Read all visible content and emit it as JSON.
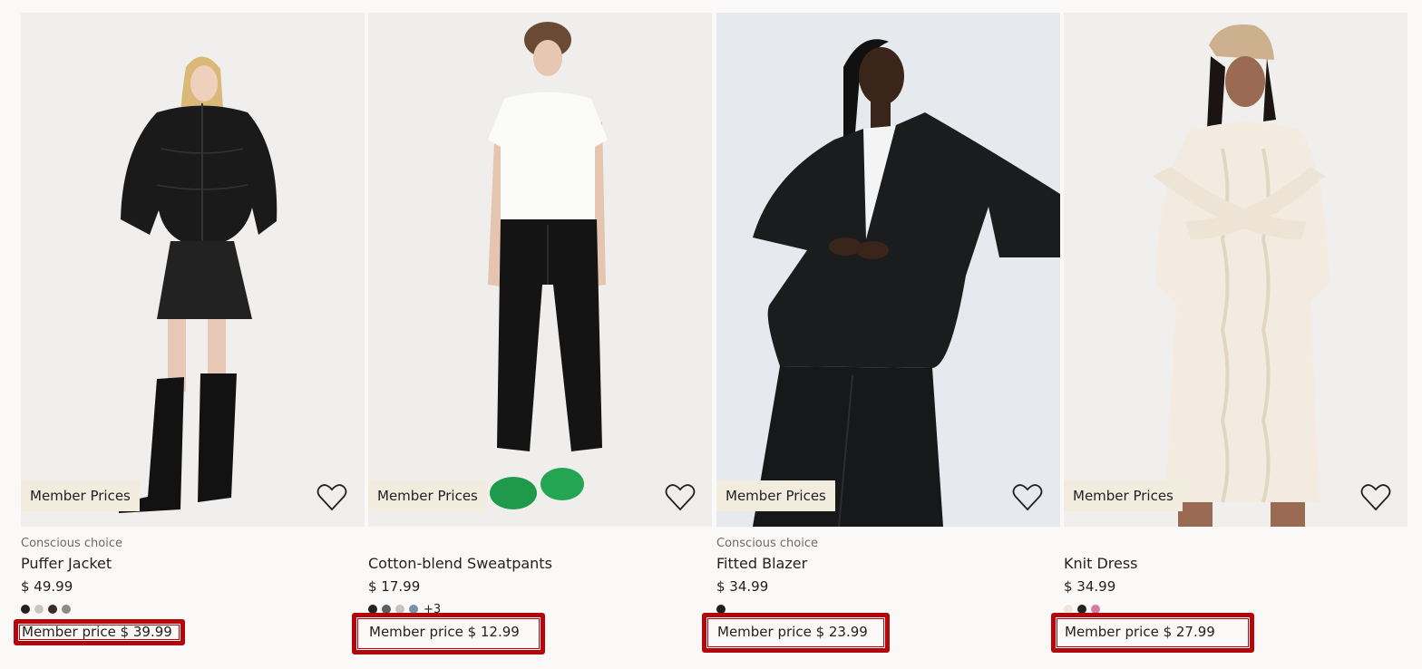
{
  "products": [
    {
      "tag": "Conscious choice",
      "name": "Puffer Jacket",
      "price": "$ 49.99",
      "badge": "Member Prices",
      "member_price": "Member price $ 39.99",
      "swatches": [
        "#222222",
        "#c9c7bd",
        "#3b2a27",
        "#8b8d84"
      ],
      "more": ""
    },
    {
      "tag": "",
      "name": "Cotton-blend Sweatpants",
      "price": "$ 17.99",
      "badge": "Member Prices",
      "member_price": "Member price $ 12.99",
      "swatches": [
        "#222222",
        "#5a5d62",
        "#c5c3bc",
        "#7e8ea3"
      ],
      "more": "+3"
    },
    {
      "tag": "Conscious choice",
      "name": "Fitted Blazer",
      "price": "$ 34.99",
      "badge": "Member Prices",
      "member_price": "Member price $ 23.99",
      "swatches": [
        "#1f1f1f"
      ],
      "more": ""
    },
    {
      "tag": "",
      "name": "Knit Dress",
      "price": "$ 34.99",
      "badge": "Member Prices",
      "member_price": "Member price $ 27.99",
      "swatches": [
        "#efe7d8",
        "#222222",
        "#d67aa6"
      ],
      "more": ""
    }
  ],
  "icons": {
    "favorite": "heart-outline-icon"
  },
  "colors": {
    "background": "#faf9f8",
    "badge_bg": "#f2ecdf",
    "highlight": "#b3070c"
  }
}
